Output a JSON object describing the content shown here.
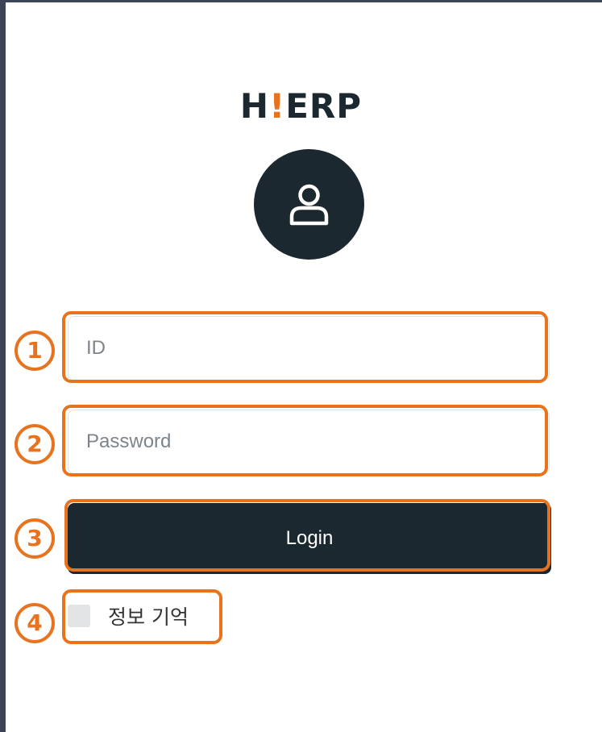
{
  "app": {
    "logo_prefix": "H",
    "logo_bang": "!",
    "logo_suffix": "ERP"
  },
  "avatar": {
    "icon": "user-icon"
  },
  "form": {
    "id_placeholder": "ID",
    "id_value": "",
    "password_placeholder": "Password",
    "password_value": "",
    "login_label": "Login",
    "remember_label": "정보 기억",
    "remember_checked": false
  },
  "annotations": {
    "color": "#e8731f",
    "markers": [
      "1",
      "2",
      "3",
      "4"
    ]
  },
  "colors": {
    "primary": "#1b2830",
    "accent": "#e8731f",
    "frame": "#3b4556"
  }
}
